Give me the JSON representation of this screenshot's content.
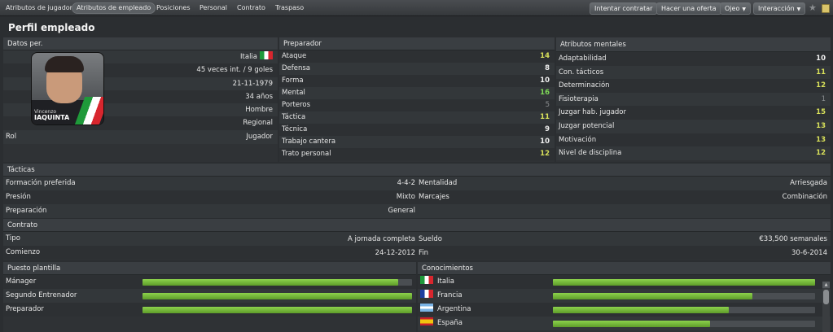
{
  "tabs": [
    "Atributos de jugador",
    "Atributos de empleado",
    "Posiciones",
    "Personal",
    "Contrato",
    "Traspaso"
  ],
  "actions": {
    "try_hire": "Intentar contratar",
    "make_offer": "Hacer una oferta",
    "eye": "Ojeo",
    "interaction": "Interacción"
  },
  "page_title": "Perfil empleado",
  "personal": {
    "header": "Datos per.",
    "nationality": "Italia",
    "caps": "45 veces int. / 9 goles",
    "birth": "21-11-1979",
    "age": "34 años",
    "gender": "Hombre",
    "level": "Regional",
    "role_label": "Rol",
    "role_value": "Jugador",
    "photo_first": "Vincenzo",
    "photo_last": "IAQUINTA"
  },
  "coach": {
    "header": "Preparador",
    "attrs": [
      {
        "label": "Ataque",
        "value": "14"
      },
      {
        "label": "Defensa",
        "value": "8"
      },
      {
        "label": "Forma",
        "value": "10"
      },
      {
        "label": "Mental",
        "value": "16"
      },
      {
        "label": "Porteros",
        "value": "5"
      },
      {
        "label": "Táctica",
        "value": "11"
      },
      {
        "label": "Técnica",
        "value": "9"
      },
      {
        "label": "Trabajo cantera",
        "value": "10"
      },
      {
        "label": "Trato personal",
        "value": "12"
      }
    ]
  },
  "mental": {
    "header": "Atributos mentales",
    "attrs": [
      {
        "label": "Adaptabilidad",
        "value": "10"
      },
      {
        "label": "Con. tácticos",
        "value": "11"
      },
      {
        "label": "Determinación",
        "value": "12"
      },
      {
        "label": "Fisioterapia",
        "value": "1"
      },
      {
        "label": "Juzgar hab. jugador",
        "value": "15"
      },
      {
        "label": "Juzgar potencial",
        "value": "13"
      },
      {
        "label": "Motivación",
        "value": "13"
      },
      {
        "label": "Nivel de disciplina",
        "value": "12"
      }
    ]
  },
  "tactics": {
    "header": "Tácticas",
    "formation_label": "Formación preferida",
    "formation": "4-4-2",
    "mentality_label": "Mentalidad",
    "mentality": "Arriesgada",
    "pressure_label": "Presión",
    "pressure": "Mixto",
    "marking_label": "Marcajes",
    "marking": "Combinación",
    "prep_label": "Preparación",
    "prep": "General"
  },
  "contract": {
    "header": "Contrato",
    "type_label": "Tipo",
    "type": "A jornada completa",
    "salary_label": "Sueldo",
    "salary": "€33,500 semanales",
    "start_label": "Comienzo",
    "start": "24-12-2012",
    "end_label": "Fin",
    "end": "30-6-2014"
  },
  "roles": {
    "header": "Puesto plantilla",
    "items": [
      {
        "label": "Mánager",
        "level": 0.95
      },
      {
        "label": "Segundo Entrenador",
        "level": 1.0
      },
      {
        "label": "Preparador",
        "level": 1.0
      }
    ]
  },
  "knowledge": {
    "header": "Conocimientos",
    "items": [
      {
        "label": "Italia",
        "flag": "it",
        "level": 1.0
      },
      {
        "label": "Francia",
        "flag": "fr",
        "level": 0.76
      },
      {
        "label": "Argentina",
        "flag": "ar",
        "level": 0.67
      },
      {
        "label": "España",
        "flag": "es",
        "level": 0.6
      }
    ]
  },
  "colors": {
    "bar_fill": "#7bc043",
    "highlight": "#d8e05a",
    "good": "#7ed957"
  }
}
